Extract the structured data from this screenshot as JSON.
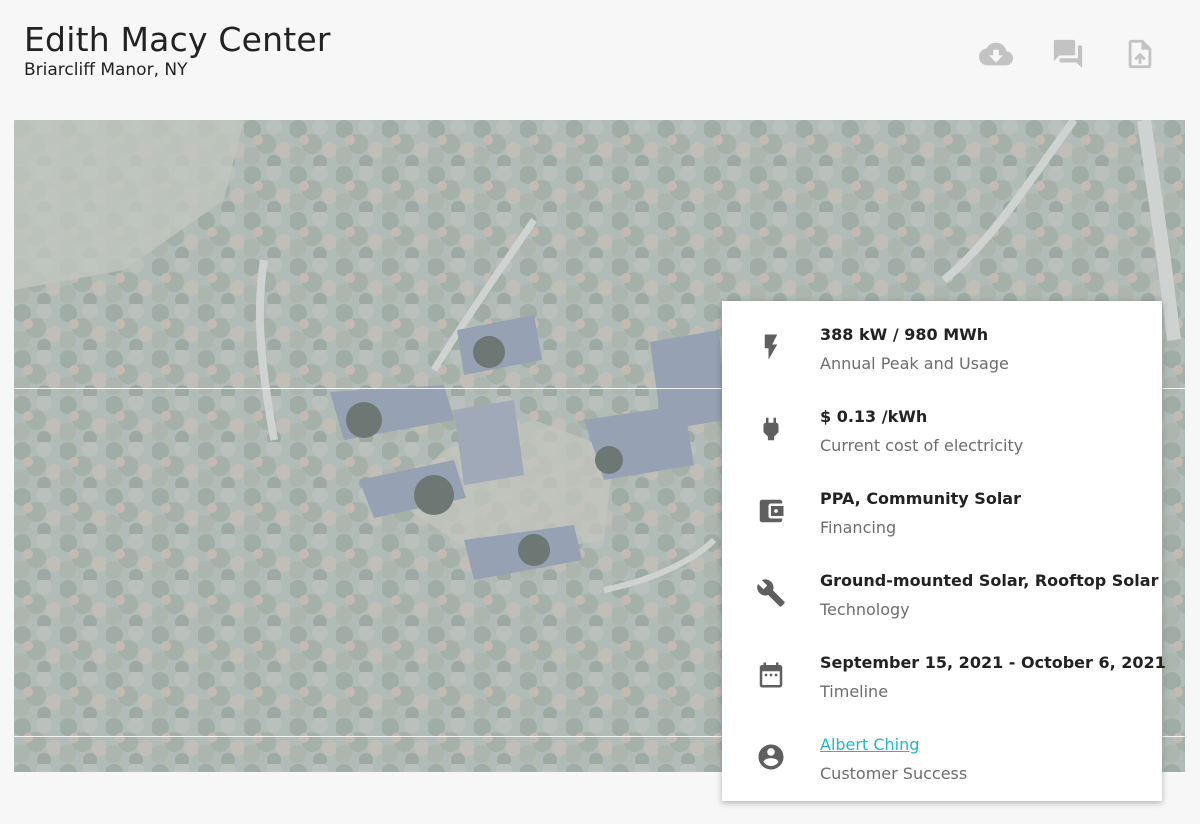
{
  "header": {
    "title": "Edith Macy Center",
    "subtitle": "Briarcliff Manor, NY",
    "actions": [
      {
        "icon": "cloud-download-icon"
      },
      {
        "icon": "forum-icon"
      },
      {
        "icon": "file-upload-icon"
      }
    ]
  },
  "map": {
    "type": "aerial-satellite-view"
  },
  "details": {
    "peak_usage": {
      "value": "388 kW / 980 MWh",
      "label": "Annual Peak and Usage",
      "icon": "bolt-icon"
    },
    "cost": {
      "value": "$ 0.13 /kWh",
      "label": "Current cost of electricity",
      "icon": "power-plug-icon"
    },
    "financing": {
      "value": "PPA, Community Solar",
      "label": "Financing",
      "icon": "wallet-icon"
    },
    "technology": {
      "value": "Ground-mounted Solar, Rooftop Solar",
      "label": "Technology",
      "icon": "wrench-icon"
    },
    "timeline": {
      "value": "September 15, 2021 - October 6, 2021",
      "label": "Timeline",
      "icon": "calendar-icon"
    },
    "contact": {
      "value": "Albert Ching",
      "label": "Customer Success",
      "icon": "account-circle-icon"
    }
  },
  "colors": {
    "accent_link": "#22b7cc",
    "icon_gray": "#5f5f5f",
    "action_icon": "#c3c3c3"
  }
}
